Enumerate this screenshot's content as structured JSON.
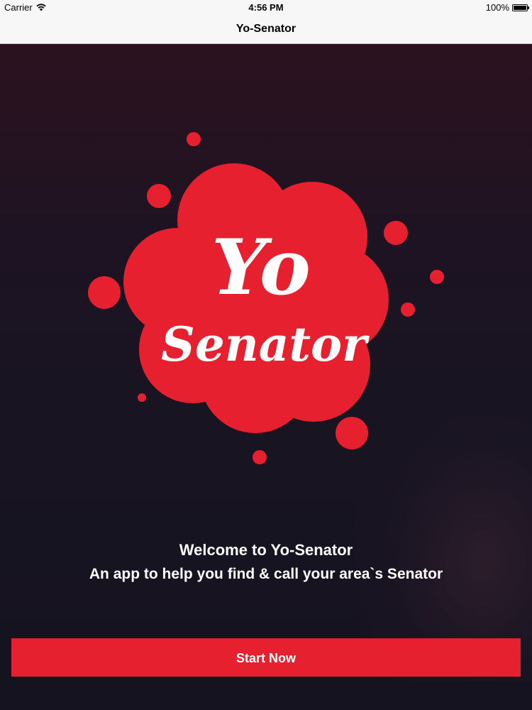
{
  "status_bar": {
    "carrier": "Carrier",
    "wifi_icon": "wifi-icon",
    "time": "4:56 PM",
    "battery_percent": "100%",
    "battery_icon": "battery-icon",
    "battery_level": 1.0
  },
  "nav_bar": {
    "title": "Yo-Senator"
  },
  "logo": {
    "line1": "Yo",
    "line2": "Senator",
    "color": "#e6202e",
    "text_color": "#ffffff"
  },
  "welcome": {
    "title": "Welcome to Yo-Senator",
    "subtitle": "An app to help you find & call your area`s Senator"
  },
  "start_button": {
    "label": "Start Now",
    "color": "#e6202e"
  }
}
